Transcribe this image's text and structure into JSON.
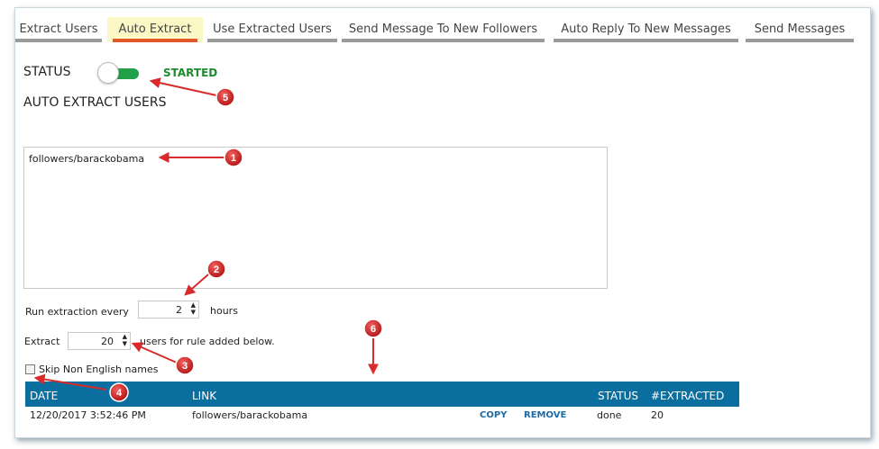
{
  "tabs": [
    {
      "label": "Extract Users",
      "active": false
    },
    {
      "label": "Auto Extract",
      "active": true
    },
    {
      "label": "Use Extracted Users",
      "active": false
    },
    {
      "label": "Send Message To New Followers",
      "active": false
    },
    {
      "label": "Auto Reply To New Messages",
      "active": false
    },
    {
      "label": "Send Messages",
      "active": false
    }
  ],
  "status": {
    "label": "STATUS",
    "state": "STARTED",
    "toggle_on": true
  },
  "section_title": "AUTO EXTRACT USERS",
  "rules_text": "followers/barackobama",
  "run_every": {
    "prefix": "Run extraction every",
    "value": "2",
    "suffix": "hours"
  },
  "extract": {
    "prefix": "Extract",
    "value": "20",
    "suffix": "users for rule added below."
  },
  "skip_non_english": {
    "label": "Skip Non English names",
    "checked": false
  },
  "table": {
    "headers": {
      "date": "DATE",
      "link": "LINK",
      "status": "STATUS",
      "extracted": "#EXTRACTED"
    },
    "rows": [
      {
        "date": "12/20/2017 3:52:46 PM",
        "link": "followers/barackobama",
        "copy": "COPY",
        "remove": "REMOVE",
        "status": "done",
        "extracted": "20"
      }
    ]
  },
  "annotations": [
    "1",
    "2",
    "3",
    "4",
    "5",
    "6"
  ],
  "colors": {
    "accent_tab": "#e2572a",
    "active_tab_bg": "#fbf8c6",
    "toggle_on": "#22a04a",
    "started_text": "#1f8a2e",
    "table_header": "#0a6e9f",
    "annotation": "#d92b2b"
  }
}
